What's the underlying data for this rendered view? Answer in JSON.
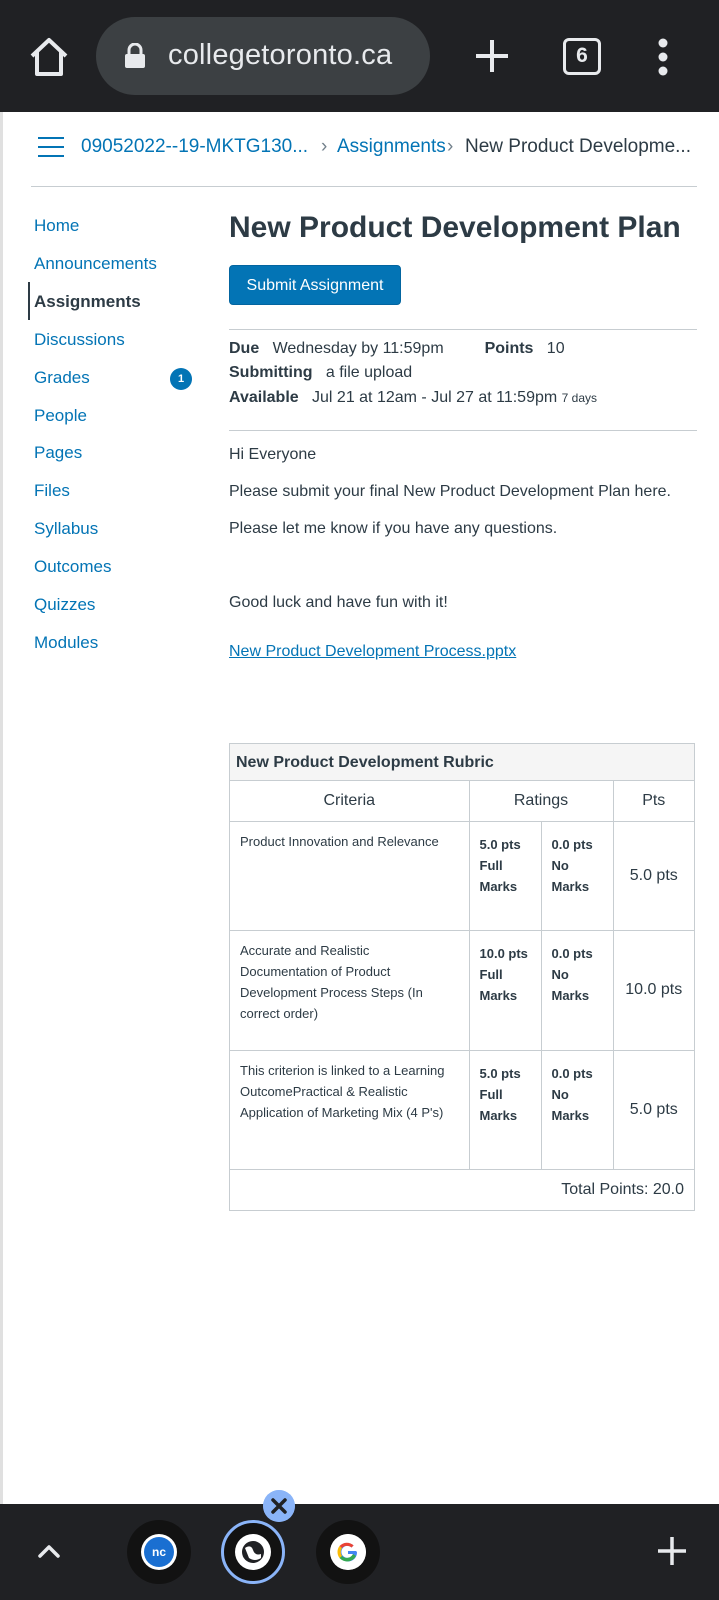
{
  "browser": {
    "url": "collegetoronto.ca",
    "tab_count": "6"
  },
  "breadcrumb": {
    "course": "09052022--19-MKTG130...",
    "section": "Assignments",
    "current": "New Product Developme..."
  },
  "nav": {
    "items": [
      {
        "label": "Home"
      },
      {
        "label": "Announcements"
      },
      {
        "label": "Assignments"
      },
      {
        "label": "Discussions"
      },
      {
        "label": "Grades"
      },
      {
        "label": "People"
      },
      {
        "label": "Pages"
      },
      {
        "label": "Files"
      },
      {
        "label": "Syllabus"
      },
      {
        "label": "Outcomes"
      },
      {
        "label": "Quizzes"
      },
      {
        "label": "Modules"
      }
    ],
    "grades_badge": "1"
  },
  "assignment": {
    "title": "New Product Development Plan",
    "submit_label": "Submit Assignment",
    "due_label": "Due",
    "due_value": "Wednesday by 11:59pm",
    "points_label": "Points",
    "points_value": "10",
    "submitting_label": "Submitting",
    "submitting_value": "a file upload",
    "available_label": "Available",
    "available_value": "Jul 21 at 12am - Jul 27 at 11:59pm",
    "available_days": "7 days",
    "body": [
      "Hi Everyone",
      "Please submit your final New Product Development Plan here.",
      "Please let me know if you have any questions.",
      "Good luck and have fun with it!"
    ],
    "file_link": "New Product Development Process.pptx"
  },
  "rubric": {
    "title": "New Product Development Rubric",
    "headers": [
      "Criteria",
      "Ratings",
      "Pts"
    ],
    "rows": [
      {
        "criterion": "Product Innovation and Relevance",
        "r1_pts": "5.0 pts",
        "r1_desc1": "Full",
        "r1_desc2": "Marks",
        "r2_pts": "0.0 pts",
        "r2_desc1": "No",
        "r2_desc2": "Marks",
        "pts": "5.0 pts"
      },
      {
        "criterion": "Accurate and Realistic Documentation of Product Development Process Steps (In correct order)",
        "r1_pts": "10.0 pts",
        "r1_desc1": "Full",
        "r1_desc2": "Marks",
        "r2_pts": "0.0 pts",
        "r2_desc1": "No",
        "r2_desc2": "Marks",
        "pts": "10.0 pts"
      },
      {
        "criterion": "This criterion is linked to a Learning OutcomePractical & Realistic Application of Marketing Mix (4 P's)",
        "r1_pts": "5.0 pts",
        "r1_desc1": "Full",
        "r1_desc2": "Marks",
        "r2_pts": "0.0 pts",
        "r2_desc1": "No",
        "r2_desc2": "Marks",
        "pts": "5.0 pts"
      }
    ],
    "total": "Total Points: 20.0"
  },
  "bottom": {
    "tab1_label": "nc"
  }
}
